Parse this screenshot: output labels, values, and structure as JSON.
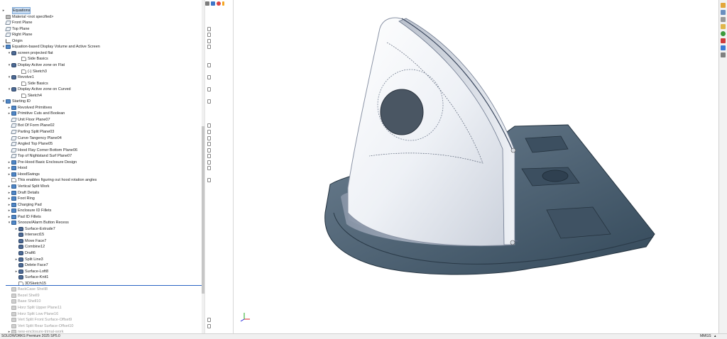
{
  "tree": [
    {
      "indent": 2,
      "exp": "▸",
      "icon": "equation",
      "label": "Equations",
      "selected": true
    },
    {
      "indent": 2,
      "exp": "",
      "icon": "material",
      "label": "Material <not specified>"
    },
    {
      "indent": 2,
      "exp": "",
      "icon": "plane",
      "label": "Front Plane"
    },
    {
      "indent": 2,
      "exp": "",
      "icon": "plane",
      "label": "Top Plane"
    },
    {
      "indent": 2,
      "exp": "",
      "icon": "plane",
      "label": "Right Plane"
    },
    {
      "indent": 2,
      "exp": "",
      "icon": "origin",
      "label": "Origin"
    },
    {
      "indent": 2,
      "exp": "▾",
      "icon": "folder",
      "label": "Equation-based Display Volume and Active Screen"
    },
    {
      "indent": 10,
      "exp": "▾",
      "icon": "body",
      "label": "screen projected flat"
    },
    {
      "indent": 24,
      "exp": "",
      "icon": "sketch",
      "label": "Side Basics"
    },
    {
      "indent": 10,
      "exp": "▾",
      "icon": "body",
      "label": "Display Active zone on Flat"
    },
    {
      "indent": 24,
      "exp": "",
      "icon": "sketch",
      "label": "(-) Sketch3"
    },
    {
      "indent": 10,
      "exp": "▾",
      "icon": "body",
      "label": "Revolve1"
    },
    {
      "indent": 24,
      "exp": "",
      "icon": "sketch",
      "label": "Side Basics"
    },
    {
      "indent": 10,
      "exp": "▾",
      "icon": "body",
      "label": "Display Active zone on Curved"
    },
    {
      "indent": 24,
      "exp": "",
      "icon": "sketch",
      "label": "Sketch4"
    },
    {
      "indent": 2,
      "exp": "▾",
      "icon": "folder",
      "label": "Starting ID"
    },
    {
      "indent": 10,
      "exp": "▸",
      "icon": "folder",
      "label": "Revolved Primitives"
    },
    {
      "indent": 10,
      "exp": "▸",
      "icon": "folder",
      "label": "Primitive Cuts and Boolean"
    },
    {
      "indent": 10,
      "exp": "",
      "icon": "plane",
      "label": "Unit Floor Plane07"
    },
    {
      "indent": 10,
      "exp": "",
      "icon": "plane",
      "label": "Bot Of Form   Plane02"
    },
    {
      "indent": 10,
      "exp": "",
      "icon": "plane",
      "label": "Parting Split   Plane03"
    },
    {
      "indent": 10,
      "exp": "",
      "icon": "plane",
      "label": "Curve-Tangency Plane04"
    },
    {
      "indent": 10,
      "exp": "",
      "icon": "plane",
      "label": "Angled Top    Plane05"
    },
    {
      "indent": 10,
      "exp": "",
      "icon": "plane",
      "label": "Hood Flay Corner Bottom Plane06"
    },
    {
      "indent": 10,
      "exp": "",
      "icon": "plane",
      "label": "Top of Nightstand Surf Plane07"
    },
    {
      "indent": 10,
      "exp": "▸",
      "icon": "folder",
      "label": "Pre-Hood Basic Enclosure Design"
    },
    {
      "indent": 10,
      "exp": "▸",
      "icon": "folder",
      "label": "Hood"
    },
    {
      "indent": 10,
      "exp": "▸",
      "icon": "folder",
      "label": "HoodSwings"
    },
    {
      "indent": 10,
      "exp": "",
      "icon": "sketch",
      "label": "This enables figuring out hood rotation angles"
    },
    {
      "indent": 10,
      "exp": "▸",
      "icon": "folder",
      "label": "Vertical Split Work"
    },
    {
      "indent": 10,
      "exp": "▸",
      "icon": "folder",
      "label": "Draft Details"
    },
    {
      "indent": 10,
      "exp": "▸",
      "icon": "folder",
      "label": "Foot Ring"
    },
    {
      "indent": 10,
      "exp": "▸",
      "icon": "folder",
      "label": "Charging Pad"
    },
    {
      "indent": 10,
      "exp": "▸",
      "icon": "folder",
      "label": "Enclosure ID Fillets"
    },
    {
      "indent": 10,
      "exp": "▸",
      "icon": "folder",
      "label": "Pad ID Fillets"
    },
    {
      "indent": 10,
      "exp": "▾",
      "icon": "folder",
      "label": "Snooze/Alarm Button Recess"
    },
    {
      "indent": 20,
      "exp": "▸",
      "icon": "body",
      "label": "Surface-Extrude7"
    },
    {
      "indent": 20,
      "exp": "",
      "icon": "body",
      "label": "Intersect15"
    },
    {
      "indent": 20,
      "exp": "",
      "icon": "body",
      "label": "Move Face7"
    },
    {
      "indent": 20,
      "exp": "",
      "icon": "body",
      "label": "Combine12"
    },
    {
      "indent": 20,
      "exp": "",
      "icon": "body",
      "label": "Draft6"
    },
    {
      "indent": 20,
      "exp": "▸",
      "icon": "body",
      "label": "Split Line3"
    },
    {
      "indent": 20,
      "exp": "",
      "icon": "body",
      "label": "Delete Face7"
    },
    {
      "indent": 20,
      "exp": "▸",
      "icon": "body",
      "label": "Surface-Loft8"
    },
    {
      "indent": 20,
      "exp": "",
      "icon": "body",
      "label": "Surface-Knit1"
    },
    {
      "indent": 20,
      "exp": "",
      "icon": "sketch",
      "label": "3DSketch15"
    },
    {
      "indent": 10,
      "exp": "",
      "icon": "gray",
      "label": "BackCase Shell8",
      "grayed": true
    },
    {
      "indent": 10,
      "exp": "",
      "icon": "gray",
      "label": "Bezel Shell9",
      "grayed": true
    },
    {
      "indent": 10,
      "exp": "",
      "icon": "gray",
      "label": "Base Shell10",
      "grayed": true
    },
    {
      "indent": 10,
      "exp": "",
      "icon": "gray",
      "label": "Horz Split Upper Plane11",
      "grayed": true
    },
    {
      "indent": 10,
      "exp": "",
      "icon": "gray",
      "label": "Horz Split Low Plane16",
      "grayed": true
    },
    {
      "indent": 10,
      "exp": "",
      "icon": "gray",
      "label": "Vert Split Front Surface-Offset9",
      "grayed": true
    },
    {
      "indent": 10,
      "exp": "",
      "icon": "gray",
      "label": "Vert Split Rear Surface-Offset10",
      "grayed": true
    },
    {
      "indent": 10,
      "exp": "▸",
      "icon": "gray",
      "label": "new-enclosure-trimal-work",
      "grayed": true
    }
  ],
  "status": {
    "app_version": "SOLIDWORKS Premium 2025 SP5.0",
    "units": "MMGS"
  },
  "colors": {
    "selection": "#c8dcf2",
    "rollback_bar": "#2a64c4",
    "model_base": "#4a5d6e",
    "model_shell": "#eef1f6"
  }
}
